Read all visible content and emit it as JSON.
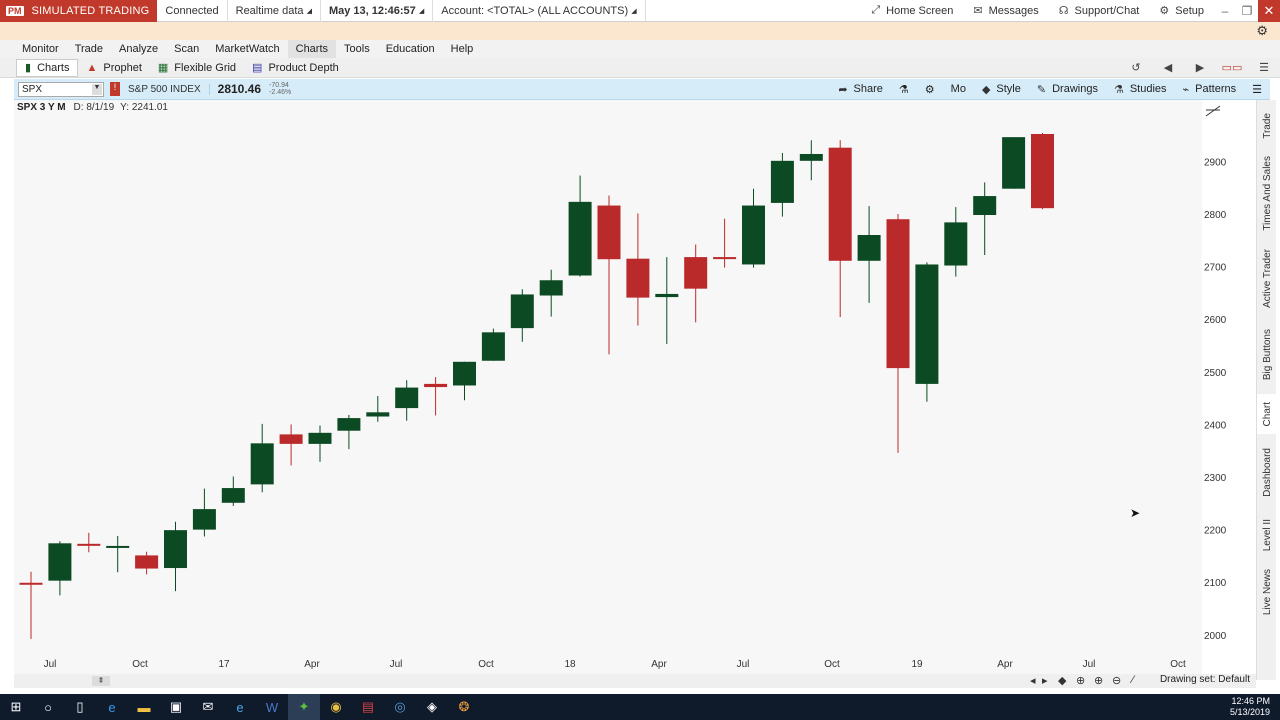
{
  "topbar": {
    "badge": "PM",
    "mode": "SIMULATED TRADING",
    "connection": "Connected",
    "data_mode": "Realtime data",
    "datetime": "May 13, 12:46:57",
    "account": "Account: <TOTAL> (ALL ACCOUNTS)",
    "home_screen": "Home Screen",
    "messages": "Messages",
    "support": "Support/Chat",
    "setup": "Setup"
  },
  "menu": [
    "Monitor",
    "Trade",
    "Analyze",
    "Scan",
    "MarketWatch",
    "Charts",
    "Tools",
    "Education",
    "Help"
  ],
  "menu_active": "Charts",
  "subtabs": {
    "charts": "Charts",
    "prophet": "Prophet",
    "flexible_grid": "Flexible Grid",
    "product_depth": "Product Depth"
  },
  "chartbar": {
    "symbol": "SPX",
    "alert": "!",
    "description": "S&P 500 INDEX",
    "last_price": "2810.46",
    "change_1": "-70.94",
    "change_2": "-2.46%",
    "share": "Share",
    "period": "Mo",
    "style": "Style",
    "drawings": "Drawings",
    "studies": "Studies",
    "patterns": "Patterns"
  },
  "chartinfo": {
    "title": "SPX 3 Y M",
    "date": "D: 8/1/19",
    "yval": "Y: 2241.01"
  },
  "sidetabs": [
    "Trade",
    "Times And Sales",
    "Active Trader",
    "Big Buttons",
    "Chart",
    "Dashboard",
    "Level II",
    "Live News"
  ],
  "sidetab_active": "Chart",
  "bottom": {
    "drawing_set": "Drawing set: Default"
  },
  "taskbar": {
    "time": "12:46 PM",
    "date": "5/13/2019"
  },
  "colors": {
    "up": "#0b4a22",
    "down": "#bb2a2a",
    "chart_bg": "#f7f7f7",
    "header_blue": "#d6ecf8"
  },
  "chart_data": {
    "type": "candlestick",
    "title": "SPX 3 Y M",
    "x_tick_labels": [
      "Jul",
      "Oct",
      "17",
      "Apr",
      "Jul",
      "Oct",
      "18",
      "Apr",
      "Jul",
      "Oct",
      "19",
      "Apr",
      "Jul",
      "Oct"
    ],
    "y_tick_labels": [
      2000,
      2100,
      2200,
      2300,
      2400,
      2500,
      2600,
      2700,
      2800,
      2900
    ],
    "ylim": [
      1975,
      2990
    ],
    "candles": [
      {
        "o": 2099,
        "h": 2120,
        "l": 1992,
        "c": 2098
      },
      {
        "o": 2103,
        "h": 2178,
        "l": 2075,
        "c": 2174
      },
      {
        "o": 2173,
        "h": 2194,
        "l": 2157,
        "c": 2170
      },
      {
        "o": 2168,
        "h": 2188,
        "l": 2119,
        "c": 2169
      },
      {
        "o": 2151,
        "h": 2158,
        "l": 2115,
        "c": 2126
      },
      {
        "o": 2127,
        "h": 2215,
        "l": 2083,
        "c": 2199
      },
      {
        "o": 2200,
        "h": 2278,
        "l": 2187,
        "c": 2239
      },
      {
        "o": 2251,
        "h": 2301,
        "l": 2245,
        "c": 2279
      },
      {
        "o": 2286,
        "h": 2401,
        "l": 2271,
        "c": 2364
      },
      {
        "o": 2381,
        "h": 2400,
        "l": 2322,
        "c": 2363
      },
      {
        "o": 2363,
        "h": 2398,
        "l": 2329,
        "c": 2384
      },
      {
        "o": 2388,
        "h": 2418,
        "l": 2353,
        "c": 2412
      },
      {
        "o": 2415,
        "h": 2454,
        "l": 2405,
        "c": 2423
      },
      {
        "o": 2431,
        "h": 2484,
        "l": 2407,
        "c": 2470
      },
      {
        "o": 2477,
        "h": 2490,
        "l": 2417,
        "c": 2471
      },
      {
        "o": 2474,
        "h": 2519,
        "l": 2446,
        "c": 2519
      },
      {
        "o": 2521,
        "h": 2582,
        "l": 2521,
        "c": 2575
      },
      {
        "o": 2583,
        "h": 2657,
        "l": 2557,
        "c": 2647
      },
      {
        "o": 2645,
        "h": 2694,
        "l": 2605,
        "c": 2674
      },
      {
        "o": 2683,
        "h": 2873,
        "l": 2681,
        "c": 2823
      },
      {
        "o": 2816,
        "h": 2835,
        "l": 2533,
        "c": 2714
      },
      {
        "o": 2715,
        "h": 2801,
        "l": 2588,
        "c": 2641
      },
      {
        "o": 2642,
        "h": 2718,
        "l": 2553,
        "c": 2648
      },
      {
        "o": 2718,
        "h": 2742,
        "l": 2594,
        "c": 2658
      },
      {
        "o": 2718,
        "h": 2791,
        "l": 2698,
        "c": 2717
      },
      {
        "o": 2704,
        "h": 2848,
        "l": 2698,
        "c": 2816
      },
      {
        "o": 2821,
        "h": 2916,
        "l": 2795,
        "c": 2901
      },
      {
        "o": 2901,
        "h": 2940,
        "l": 2864,
        "c": 2914
      },
      {
        "o": 2926,
        "h": 2940,
        "l": 2604,
        "c": 2711
      },
      {
        "o": 2711,
        "h": 2815,
        "l": 2631,
        "c": 2760
      },
      {
        "o": 2790,
        "h": 2800,
        "l": 2346,
        "c": 2507
      },
      {
        "o": 2477,
        "h": 2708,
        "l": 2443,
        "c": 2704
      },
      {
        "o": 2702,
        "h": 2813,
        "l": 2681,
        "c": 2784
      },
      {
        "o": 2798,
        "h": 2860,
        "l": 2722,
        "c": 2834
      },
      {
        "o": 2848,
        "h": 2946,
        "l": 2848,
        "c": 2946
      },
      {
        "o": 2952,
        "h": 2954,
        "l": 2809,
        "c": 2811
      }
    ]
  }
}
